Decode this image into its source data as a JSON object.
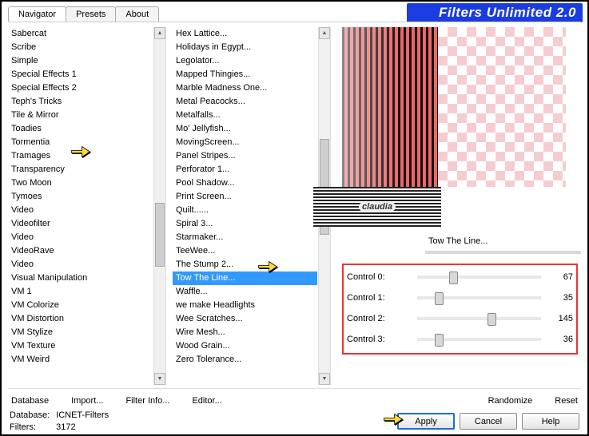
{
  "header": {
    "title": "Filters Unlimited 2.0",
    "tabs": [
      "Navigator",
      "Presets",
      "About"
    ],
    "active_tab": 0
  },
  "category_list": {
    "items": [
      "Sabercat",
      "Scribe",
      "Simple",
      "Special Effects 1",
      "Special Effects 2",
      "Teph's Tricks",
      "Tile & Mirror",
      "Toadies",
      "Tormentia",
      "Tramages",
      "Transparency",
      "Two Moon",
      "Tymoes",
      "Video",
      "Videofilter",
      "Video",
      "VideoRave",
      "Video",
      "Visual Manipulation",
      "VM 1",
      "VM Colorize",
      "VM Distortion",
      "VM Stylize",
      "VM Texture",
      "VM Weird"
    ],
    "highlighted_index": 9
  },
  "filter_list": {
    "items": [
      "Hex Lattice...",
      "Holidays in Egypt...",
      "Legolator...",
      "Mapped Thingies...",
      "Marble Madness One...",
      "Metal Peacocks...",
      "Metalfalls...",
      "Mo' Jellyfish...",
      "MovingScreen...",
      "Panel Stripes...",
      "Perforator 1...",
      "Pool Shadow...",
      "Print Screen...",
      "Quilt......",
      "Spiral 3...",
      "Starmaker...",
      "TeeWee...",
      "The Stump 2...",
      "Tow The Line...",
      "Waffle...",
      "we make Headlights",
      "Wee Scratches...",
      "Wire Mesh...",
      "Wood Grain...",
      "Zero Tolerance..."
    ],
    "selected_index": 18
  },
  "watermark": "claudia",
  "selected_filter_name": "Tow The Line...",
  "controls": [
    {
      "label": "Control 0:",
      "value": 67,
      "pos": 26
    },
    {
      "label": "Control 1:",
      "value": 35,
      "pos": 14
    },
    {
      "label": "Control 2:",
      "value": 145,
      "pos": 57
    },
    {
      "label": "Control 3:",
      "value": 36,
      "pos": 14
    }
  ],
  "bottom_links": {
    "database": "Database",
    "import": "Import...",
    "filter_info": "Filter Info...",
    "editor": "Editor...",
    "randomize": "Randomize",
    "reset": "Reset"
  },
  "db_info": {
    "db_label": "Database:",
    "db_value": "ICNET-Filters",
    "filters_label": "Filters:",
    "filters_value": "3172"
  },
  "buttons": {
    "apply": "Apply",
    "cancel": "Cancel",
    "help": "Help"
  }
}
